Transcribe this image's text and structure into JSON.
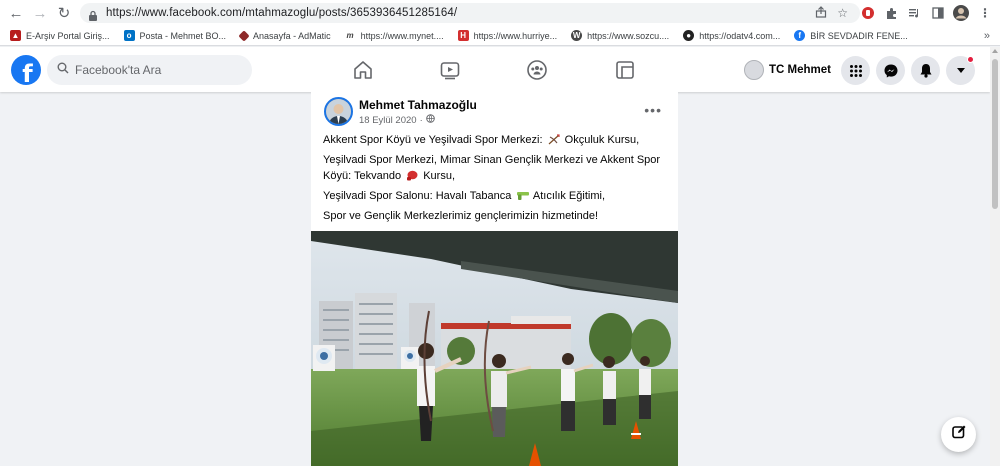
{
  "browser": {
    "url": "https://www.facebook.com/mtahmazoglu/posts/3653936451285164/",
    "bookmarks": [
      {
        "label": "E-Arşiv Portal Giriş...",
        "icon": "earsiv-favicon",
        "color": "#b71c1c"
      },
      {
        "label": "Posta - Mehmet BO...",
        "icon": "outlook-favicon",
        "color": "#0072c6"
      },
      {
        "label": "Anasayfa - AdMatic",
        "icon": "admatic-favicon",
        "color": "#8e2a2a"
      },
      {
        "label": "https://www.mynet....",
        "icon": "mynet-favicon",
        "color": "#444444"
      },
      {
        "label": "https://www.hurriye...",
        "icon": "hurriyet-favicon",
        "color": "#d32f2f"
      },
      {
        "label": "https://www.sozcu....",
        "icon": "wordpress-favicon",
        "color": "#464646"
      },
      {
        "label": "https://odatv4.com...",
        "icon": "odatv-favicon",
        "color": "#222222"
      },
      {
        "label": "BİR SEVDADIR FENE...",
        "icon": "facebook-favicon",
        "color": "#1877f2"
      }
    ]
  },
  "facebook": {
    "search_placeholder": "Facebook'ta Ara",
    "user_name": "TC Mehmet",
    "brand_color": "#1877f2",
    "nav_tabs": [
      "home-icon",
      "watch-icon",
      "groups-icon",
      "gaming-icon"
    ]
  },
  "post": {
    "author": "Mehmet Tahmazoğlu",
    "date": "18 Eylül 2020",
    "lines": {
      "l1_a": "Akkent Spor Köyü ve Yeşilvadi Spor Merkezi:",
      "l1_b": "Okçuluk Kursu,",
      "l2_a": "Yeşilvadi Spor Merkezi, Mimar Sinan Gençlik Merkezi ve Akkent Spor Köyü: Tekvando",
      "l2_b": "Kursu,",
      "l3_a": "Yeşilvadi Spor Salonu: Havalı Tabanca",
      "l3_b": "Atıcılık Eğitimi,",
      "l4": "Spor ve Gençlik Merkezlerimiz gençlerimizin hizmetinde!"
    }
  }
}
